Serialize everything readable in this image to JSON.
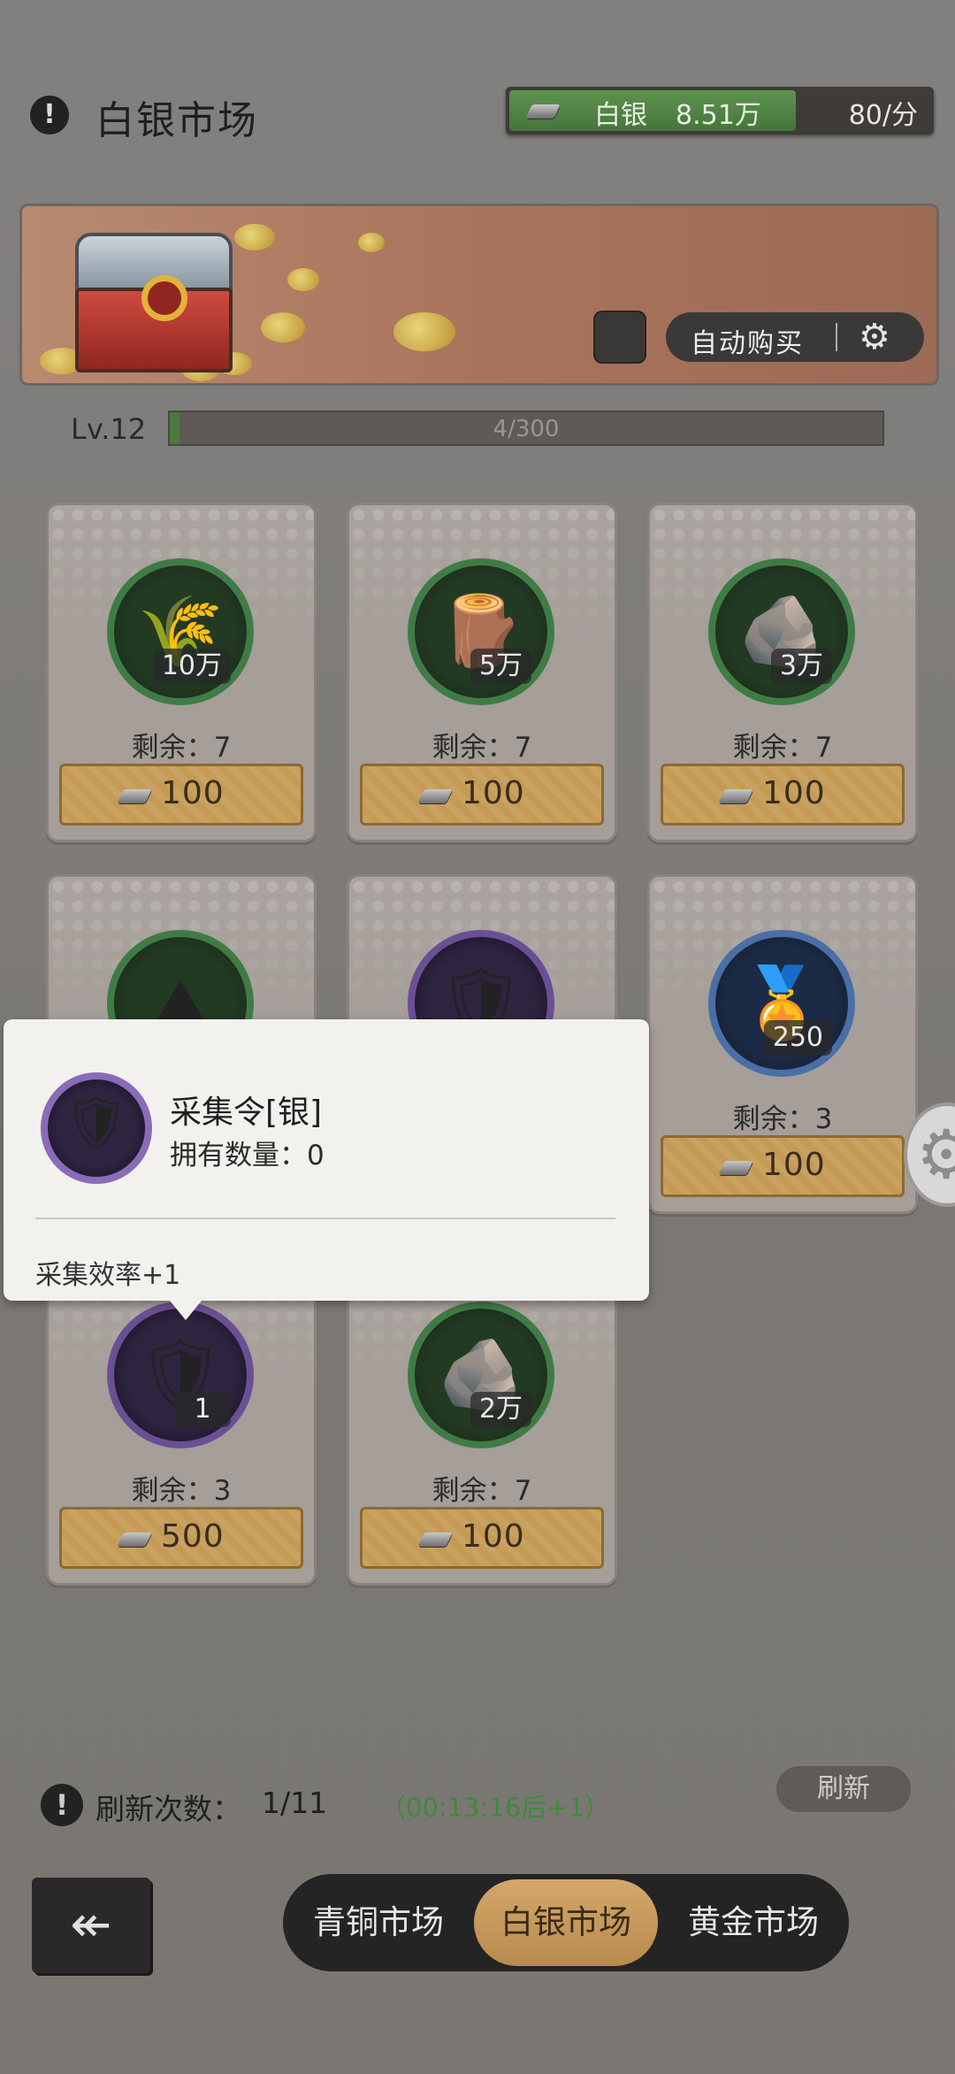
{
  "header": {
    "title": "白银市场",
    "currency": {
      "name": "白银",
      "amount": "8.51万",
      "rate": "80/分"
    }
  },
  "banner": {
    "auto_buy_label": "自动购买"
  },
  "level": {
    "label": "Lv.12",
    "progress_text": "4/300",
    "progress_fraction": 0.0133
  },
  "cards": [
    {
      "name": "wheat",
      "badge": "10万",
      "remain": "剩余：7",
      "price": "100",
      "ring": "green",
      "glyph": "🌾"
    },
    {
      "name": "wood-log",
      "badge": "5万",
      "remain": "剩余：7",
      "price": "100",
      "ring": "green",
      "glyph": "🪵"
    },
    {
      "name": "stone",
      "badge": "3万",
      "remain": "剩余：7",
      "price": "100",
      "ring": "green",
      "glyph": "🪨"
    },
    {
      "name": "iron-ore",
      "badge": "",
      "remain": "",
      "price": "",
      "ring": "green",
      "glyph": "⛰"
    },
    {
      "name": "gather-token",
      "badge": "",
      "remain": "",
      "price": "",
      "ring": "purple",
      "glyph": "🛡"
    },
    {
      "name": "medal",
      "badge": "250",
      "remain": "剩余：3",
      "price": "100",
      "ring": "blue",
      "glyph": "🏅"
    },
    {
      "name": "gather-token-silver",
      "badge": "1",
      "remain": "剩余：3",
      "price": "500",
      "ring": "purple",
      "glyph": "🛡"
    },
    {
      "name": "ore",
      "badge": "2万",
      "remain": "剩余：7",
      "price": "100",
      "ring": "green",
      "glyph": "🪨"
    }
  ],
  "tooltip": {
    "title": "采集令[银]",
    "owned": "拥有数量：0",
    "description": "采集效率+1"
  },
  "refresh": {
    "label": "刷新次数：",
    "count": "1/11",
    "timer": "（00:13:16后+1）",
    "button": "刷新"
  },
  "nav": {
    "back_icon": "back-arrow-icon",
    "tabs": [
      "青铜市场",
      "白银市场",
      "黄金市场"
    ],
    "active_tab": 1
  },
  "colors": {
    "buy_button": "#c59a55",
    "green_ring": "#3f7c45",
    "purple_ring": "#6b4f95",
    "blue_ring": "#4a6fa6",
    "timer": "#3f8a3a",
    "active_tab": "#c99c5c"
  }
}
